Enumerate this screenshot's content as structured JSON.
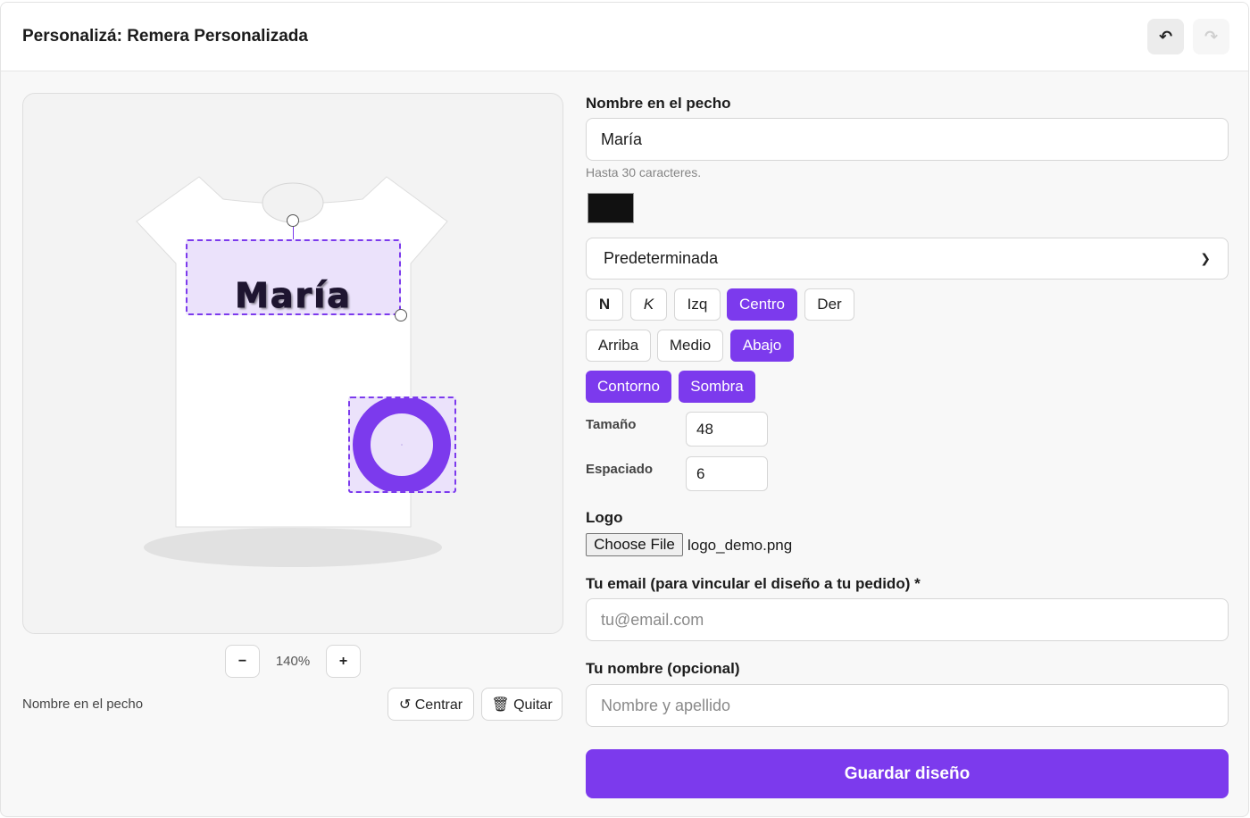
{
  "header": {
    "title": "Personalizá: Remera Personalizada",
    "undo_icon": "↶",
    "redo_icon": "↷"
  },
  "preview": {
    "name_text": "María",
    "zoom_out": "−",
    "zoom_in": "+",
    "zoom_level": "140%",
    "selected_label": "Nombre en el pecho",
    "center_button": "↺ Centrar",
    "remove_button": "🗑 Quitar",
    "colors": {
      "accent": "#7c3aed",
      "selection_fill": "#ebe2fb",
      "text_color": "#1e1530"
    }
  },
  "form": {
    "name_label": "Nombre en el pecho",
    "name_value": "María",
    "name_hint": "Hasta 30 caracteres.",
    "text_color": "#111111",
    "font_select": "Predeterminada",
    "style_buttons": {
      "bold": "N",
      "italic": "K",
      "left": "Izq",
      "center": "Centro",
      "right": "Der"
    },
    "vertical_buttons": {
      "top": "Arriba",
      "middle": "Medio",
      "bottom": "Abajo"
    },
    "effect_buttons": {
      "outline": "Contorno",
      "shadow": "Sombra"
    },
    "size_label": "Tamaño",
    "size_value": "48",
    "spacing_label": "Espaciado",
    "spacing_value": "6",
    "logo_label": "Logo",
    "file_button": "Choose File",
    "file_name": "logo_demo.png",
    "email_label": "Tu email (para vincular el diseño a tu pedido) *",
    "email_placeholder": "tu@email.com",
    "customer_name_label": "Tu nombre (opcional)",
    "customer_name_placeholder": "Nombre y apellido",
    "save_button": "Guardar diseño"
  }
}
